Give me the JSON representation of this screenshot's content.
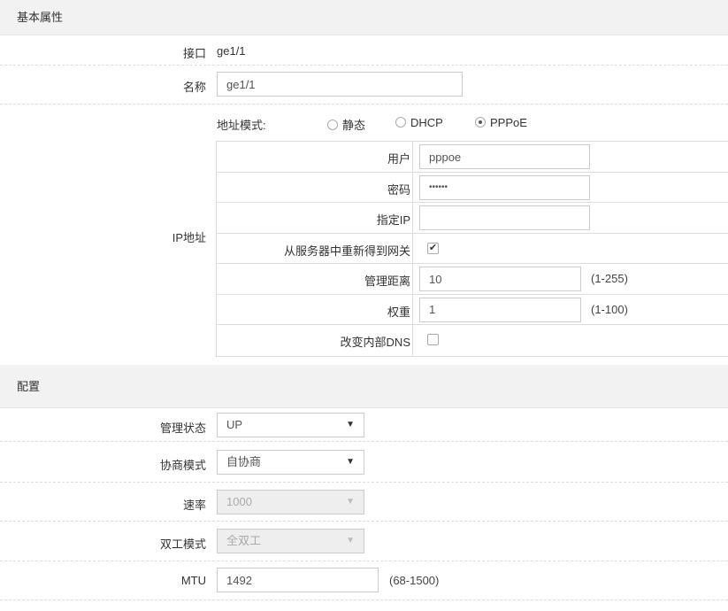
{
  "basic": {
    "header": "基本属性",
    "interface_label": "接口",
    "interface_value": "ge1/1",
    "name_label": "名称",
    "name_value": "ge1/1"
  },
  "ip": {
    "label": "IP地址",
    "mode_label": "地址模式:",
    "mode_options": [
      "静态",
      "DHCP",
      "PPPoE"
    ],
    "mode_selected": "PPPoE",
    "user_label": "用户",
    "user_value": "pppoe",
    "password_label": "密码",
    "password_value": "••••••",
    "specify_ip_label": "指定IP",
    "specify_ip_value": "",
    "regain_gateway_label": "从服务器中重新得到网关",
    "regain_gateway_checked": true,
    "admin_distance_label": "管理距离",
    "admin_distance_value": "10",
    "admin_distance_range": "(1-255)",
    "weight_label": "权重",
    "weight_value": "1",
    "weight_range": "(1-100)",
    "change_dns_label": "改变内部DNS",
    "change_dns_checked": false
  },
  "config": {
    "header": "配置",
    "admin_status_label": "管理状态",
    "admin_status_value": "UP",
    "negotiation_label": "协商模式",
    "negotiation_value": "自协商",
    "speed_label": "速率",
    "speed_value": "1000",
    "duplex_label": "双工模式",
    "duplex_value": "全双工",
    "mtu_label": "MTU",
    "mtu_value": "1492",
    "mtu_range": "(68-1500)"
  }
}
